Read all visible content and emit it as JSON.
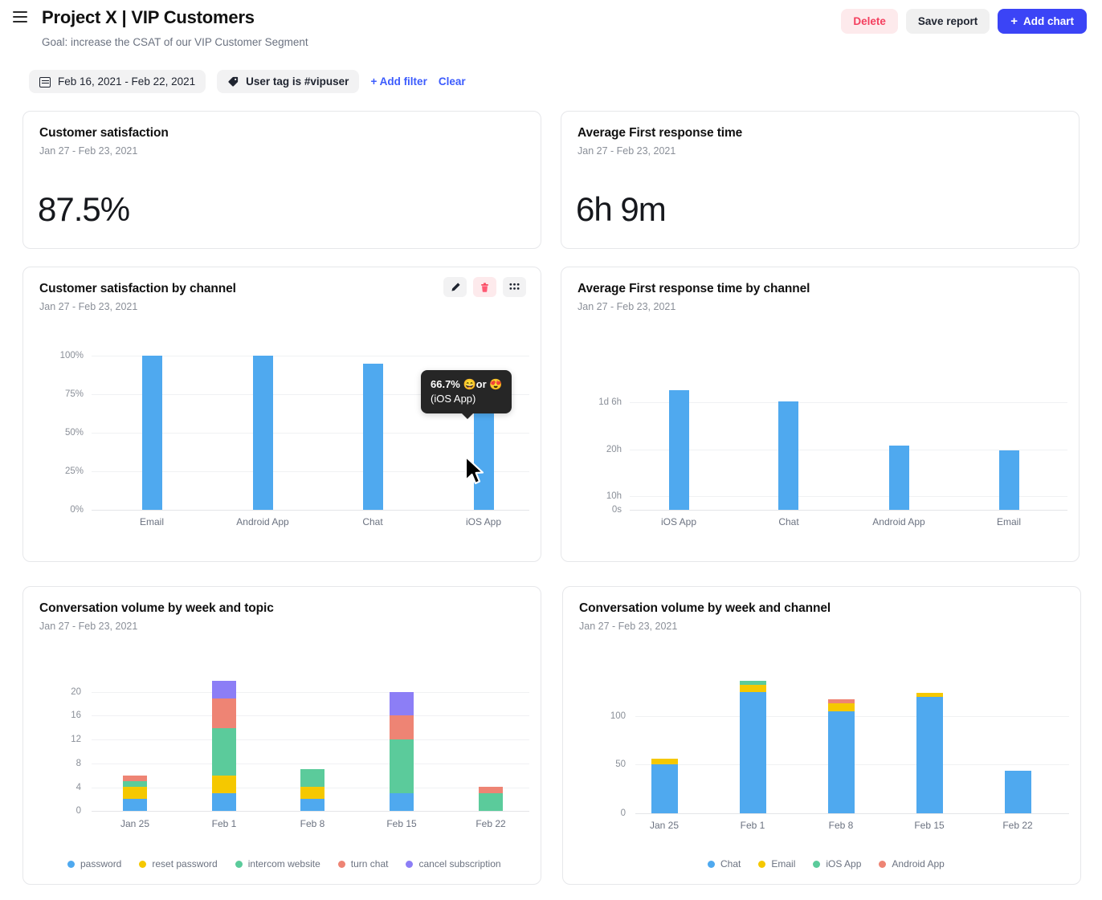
{
  "header": {
    "menu_icon": "hamburger-icon",
    "title": "Project X | VIP Customers",
    "subtitle": "Goal: increase the CSAT of our VIP Customer Segment",
    "delete_label": "Delete",
    "save_label": "Save report",
    "add_chart_label": "Add chart",
    "add_chart_plus": "+"
  },
  "filters": {
    "date_range": "Feb 16, 2021 - Feb 22, 2021",
    "tag_filter": "User tag is #vipuser",
    "add_filter_label": "+ Add filter",
    "clear_label": "Clear"
  },
  "colors": {
    "brand_blue": "#3b44f6",
    "link_blue": "#3b5bfd",
    "bar_blue": "#4fa9ef",
    "yellow": "#f5c800",
    "green": "#5bcb9b",
    "salmon": "#ee8474",
    "purple": "#8c7ef6",
    "danger": "#f43f5e"
  },
  "cards": {
    "csat": {
      "title": "Customer satisfaction",
      "subtitle": "Jan 27 - Feb 23, 2021",
      "value": "87.5%"
    },
    "frt": {
      "title": "Average First response time",
      "subtitle": "Jan 27 - Feb 23, 2021",
      "value": "6h 9m"
    },
    "csat_by_channel": {
      "title": "Customer satisfaction by channel",
      "subtitle": "Jan 27 - Feb 23, 2021",
      "tools": {
        "edit": "edit-icon",
        "delete": "trash-icon",
        "drag": "drag-handle-icon"
      },
      "tooltip": {
        "line1": "66.7% 😄or 😍",
        "line2": "(iOS App)"
      }
    },
    "frt_by_channel": {
      "title": "Average First response time by channel",
      "subtitle": "Jan 27 - Feb 23, 2021"
    },
    "volume_by_topic": {
      "title": "Conversation volume by week and topic",
      "subtitle": "Jan 27 - Feb 23, 2021"
    },
    "volume_by_channel": {
      "title": "Conversation volume by week and channel",
      "subtitle": "Jan 27 - Feb 23, 2021"
    }
  },
  "chart_data": [
    {
      "id": "csat_by_channel",
      "type": "bar",
      "title": "Customer satisfaction by channel",
      "xlabel": "",
      "ylabel": "",
      "categories": [
        "Email",
        "Android App",
        "Chat",
        "iOS App"
      ],
      "values": [
        100,
        100,
        95,
        66.7
      ],
      "ytick_labels": [
        "0%",
        "25%",
        "50%",
        "75%",
        "100%"
      ],
      "ytick_values": [
        0,
        25,
        50,
        75,
        100
      ],
      "ylim": [
        0,
        100
      ],
      "grid": true,
      "legend": "none",
      "color": "#4fa9ef"
    },
    {
      "id": "frt_by_channel",
      "type": "bar",
      "title": "Average First response time by channel",
      "xlabel": "",
      "ylabel": "",
      "categories": [
        "iOS App",
        "Chat",
        "Android App",
        "Email"
      ],
      "values": [
        31.5,
        28.5,
        19.4,
        18.3
      ],
      "value_labels": [
        "1d 7h 30m",
        "1d 4h 30m",
        "19h 24m",
        "18h 18m"
      ],
      "ytick_labels": [
        "0s",
        "10h",
        "20h",
        "1d 6h"
      ],
      "ytick_values": [
        0,
        10,
        20,
        30
      ],
      "ylim": [
        0,
        33
      ],
      "grid": true,
      "legend": "none",
      "color": "#4fa9ef"
    },
    {
      "id": "volume_by_topic",
      "type": "bar",
      "stacked": true,
      "title": "Conversation volume by week and topic",
      "xlabel": "",
      "ylabel": "",
      "categories": [
        "Jan 25",
        "Feb 1",
        "Feb 8",
        "Feb 15",
        "Feb 22"
      ],
      "series": [
        {
          "name": "password",
          "color": "#4fa9ef",
          "values": [
            2,
            3,
            2,
            3,
            0
          ]
        },
        {
          "name": "reset password",
          "color": "#f5c800",
          "values": [
            2,
            3,
            2,
            0,
            0
          ]
        },
        {
          "name": "intercom website",
          "color": "#5bcb9b",
          "values": [
            1,
            8,
            3,
            9,
            3
          ]
        },
        {
          "name": "turn chat",
          "color": "#ee8474",
          "values": [
            1,
            5,
            0,
            4,
            1
          ]
        },
        {
          "name": "cancel subscription",
          "color": "#8c7ef6",
          "values": [
            0,
            3,
            0,
            4,
            0
          ]
        }
      ],
      "totals": [
        6,
        22,
        7,
        20,
        4
      ],
      "ytick_labels": [
        "0",
        "4",
        "8",
        "12",
        "16",
        "20"
      ],
      "ytick_values": [
        0,
        4,
        8,
        12,
        16,
        20
      ],
      "ylim": [
        0,
        22
      ],
      "grid": true,
      "legend": "bottom"
    },
    {
      "id": "volume_by_channel",
      "type": "bar",
      "stacked": true,
      "title": "Conversation volume by week and channel",
      "xlabel": "",
      "ylabel": "",
      "categories": [
        "Jan 25",
        "Feb 1",
        "Feb 8",
        "Feb 15",
        "Feb 22"
      ],
      "series": [
        {
          "name": "Chat",
          "color": "#4fa9ef",
          "values": [
            50,
            125,
            105,
            120,
            44
          ]
        },
        {
          "name": "Email",
          "color": "#f5c800",
          "values": [
            6,
            7,
            8,
            4,
            0
          ]
        },
        {
          "name": "iOS App",
          "color": "#5bcb9b",
          "values": [
            0,
            4,
            0,
            0,
            0
          ]
        },
        {
          "name": "Android App",
          "color": "#ee8474",
          "values": [
            0,
            0,
            4,
            0,
            0
          ]
        }
      ],
      "totals": [
        56,
        136,
        117,
        124,
        44
      ],
      "ytick_labels": [
        "0",
        "50",
        "100"
      ],
      "ytick_values": [
        0,
        50,
        100
      ],
      "ylim": [
        0,
        143
      ],
      "grid": true,
      "legend": "bottom"
    }
  ]
}
